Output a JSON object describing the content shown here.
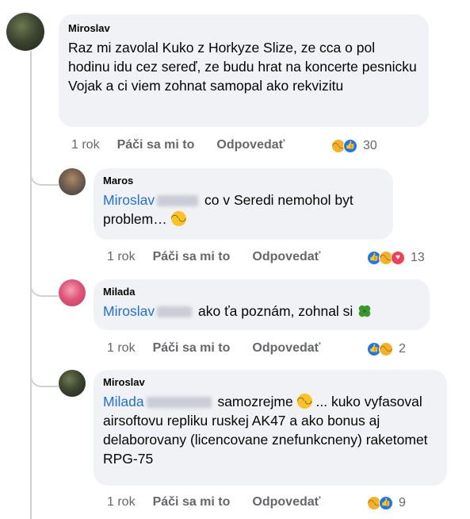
{
  "colors": {
    "bubble": "#f0f2f5",
    "mention": "#216fdb",
    "secondary_text": "#65676b",
    "like": "#1877f2",
    "haha": "#f7b125",
    "love": "#f33e58"
  },
  "comments": [
    {
      "author": "Miroslav",
      "text": "Raz mi zavolal Kuko z Horkyze Slize, ze cca o pol hodinu idu cez sereď, ze budu hrat na koncerte pesnicku Vojak a ci viem zohnat samopal ako rekvizitu",
      "time": "1 rok",
      "like_label": "Páči sa mi to",
      "reply_label": "Odpovedať",
      "reactions": [
        "haha-icon",
        "like-icon"
      ],
      "reaction_count": "30"
    },
    {
      "author": "Maros",
      "mention": "Miroslav",
      "text_1": "co v Seredi nemohol byt",
      "text_2": "problem…",
      "time": "1 rok",
      "like_label": "Páči sa mi to",
      "reply_label": "Odpovedať",
      "reactions": [
        "like-icon",
        "haha-icon",
        "love-icon"
      ],
      "reaction_count": "13"
    },
    {
      "author": "Milada",
      "mention": "Miroslav",
      "text": "ako ťa poznám, zohnal si",
      "time": "1 rok",
      "like_label": "Páči sa mi to",
      "reply_label": "Odpovedať",
      "reactions": [
        "like-icon",
        "haha-icon"
      ],
      "reaction_count": "2"
    },
    {
      "author": "Miroslav",
      "mention": "Milada",
      "text_1": "samozrejme",
      "text_2": "... kuko",
      "text_rest": "vyfasoval airsoftovu repliku ruskej AK47 a ako bonus aj delaborovany (licencovane znefunkcneny) raketomet RPG-75",
      "time": "1 rok",
      "like_label": "Páči sa mi to",
      "reply_label": "Odpovedať",
      "reactions": [
        "haha-icon",
        "like-icon"
      ],
      "reaction_count": "9"
    }
  ]
}
